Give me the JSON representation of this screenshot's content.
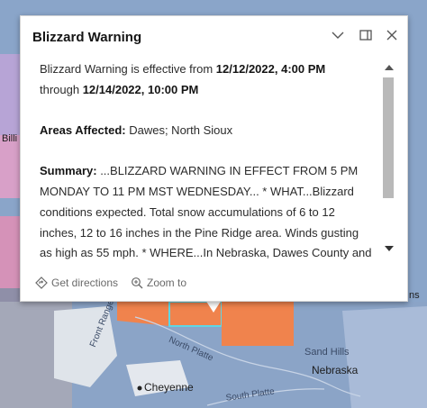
{
  "popup": {
    "title": "Blizzard Warning",
    "body": {
      "line1_prefix": "Blizzard Warning is effective from ",
      "line1_start": "12/12/2022, 4:00 PM",
      "line2_prefix": "through ",
      "line2_end": "12/14/2022, 10:00 PM",
      "areas_label": "Areas Affected:",
      "areas_value": " Dawes; North Sioux",
      "summary_label": "Summary:",
      "summary_lines": [
        " ...BLIZZARD WARNING IN EFFECT FROM 5 PM",
        "MONDAY TO 11 PM MST WEDNESDAY... * WHAT...Blizzard",
        "conditions expected. Total snow accumulations of 6 to 12",
        "inches, 12 to 16 inches in the Pine Ridge area. Winds gusting",
        "as high as 55 mph. * WHERE...In Nebraska, Dawes County and"
      ]
    },
    "actions": {
      "directions": "Get directions",
      "zoom": "Zoom to"
    }
  },
  "map": {
    "labels": {
      "cheyenne": "Cheyenne",
      "nebraska": "Nebraska",
      "sand_hills": "Sand Hills",
      "north_platte": "North Platte",
      "south_platte": "South Platte",
      "front_range": "Front Range",
      "billings": "Billi",
      "ns": "ns"
    }
  },
  "colors": {
    "blizzard": "#f0834d",
    "winter_storm": "#b7a4d6",
    "wind_chill": "#8aa5c9",
    "selection": "#5fd6e4"
  }
}
